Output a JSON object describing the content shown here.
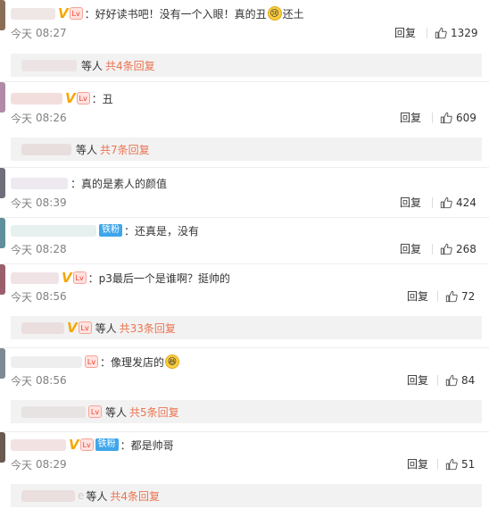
{
  "colors": {
    "accent_orange": "#eb7350",
    "meta_gray": "#808080",
    "vip_gold": "#f7a600",
    "fan_blue": "#3fa6ea",
    "subbox_bg": "#f2f2f2"
  },
  "labels": {
    "reply": "回复",
    "deng_ren": "等人",
    "v_badge": "V",
    "level_badge": "Lv",
    "fan_badge": "铁粉"
  },
  "comments": [
    {
      "user_hint": "",
      "text": "：好好读书吧！没有一个入眼！真的丑",
      "emoji_icon": "crying-face-icon",
      "text_after": "还土",
      "date": "今天",
      "time": "08:27",
      "likes": "1329",
      "replies": {
        "user_hint": "",
        "more": "共4条回复"
      }
    },
    {
      "user_hint": "茜",
      "text": "：丑",
      "date": "今天",
      "time": "08:26",
      "likes": "609",
      "replies": {
        "user_hint": "",
        "more": "共7条回复"
      }
    },
    {
      "user_hint": "a",
      "text": "：真的是素人的颜值",
      "date": "今天",
      "time": "08:39",
      "likes": "424"
    },
    {
      "user_hint": "漏",
      "text": "：还真是，没有",
      "date": "今天",
      "time": "08:28",
      "likes": "268"
    },
    {
      "user_hint": "",
      "text": "：p3最后一个是谁啊？挺帅的",
      "date": "今天",
      "time": "08:56",
      "likes": "72",
      "replies": {
        "user_hint": "",
        "more": "共33条回复"
      }
    },
    {
      "user_hint": "",
      "text": "：像理发店的",
      "emoji_icon": "laughing-face-icon",
      "text_after": "",
      "date": "今天",
      "time": "08:56",
      "likes": "84",
      "replies": {
        "user_hint": "",
        "more": "共5条回复"
      }
    },
    {
      "user_hint": "呢",
      "text": "：都是帅哥",
      "date": "今天",
      "time": "08:29",
      "likes": "51",
      "replies": {
        "user_hint": "e",
        "more": "共4条回复"
      }
    }
  ]
}
